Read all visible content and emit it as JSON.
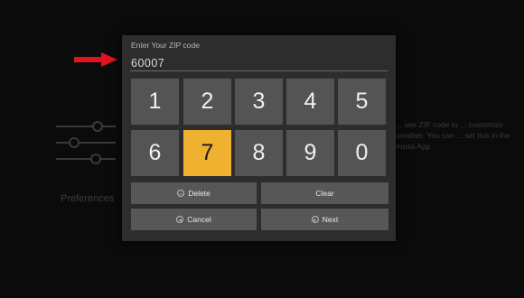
{
  "background": {
    "preferences_label": "Preferences",
    "description": "... use ZIP code to ... customize weather. You can ... set this in the Alexa App"
  },
  "zip_dialog": {
    "label": "Enter Your ZIP code",
    "value": "60007",
    "keys": [
      "1",
      "2",
      "3",
      "4",
      "5",
      "6",
      "7",
      "8",
      "9",
      "0"
    ],
    "selected_key": "7",
    "delete_label": "Delete",
    "clear_label": "Clear",
    "cancel_label": "Cancel",
    "next_label": "Next"
  },
  "colors": {
    "accent": "#f0b030",
    "arrow": "#e0141e",
    "key": "#545454",
    "dialog": "#2d2d2d"
  }
}
